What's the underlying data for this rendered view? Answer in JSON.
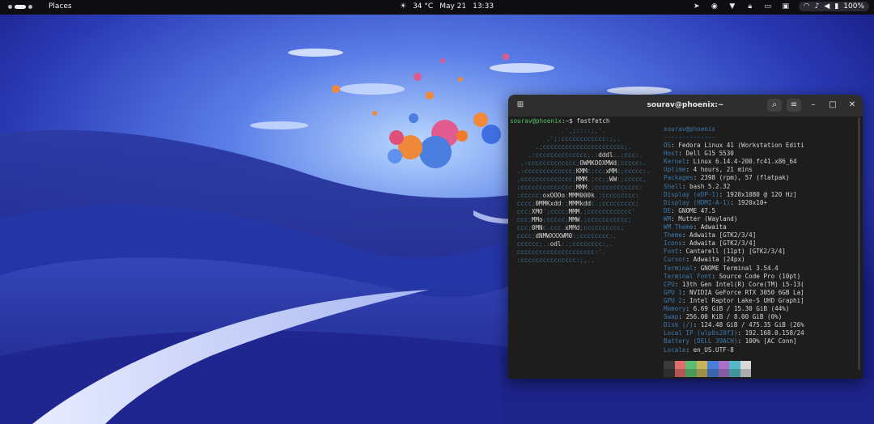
{
  "topbar": {
    "places_label": "Places",
    "weather": "34 °C",
    "date": "May 21",
    "time": "13:33",
    "tray_icons": [
      "telegram-icon",
      "discord-icon",
      "vpn-icon",
      "lock-icon",
      "flag-icon",
      "window-icon"
    ],
    "battery": "100%"
  },
  "terminal": {
    "title": "sourav@phoenix:~",
    "prompt_user": "sourav@phoenix",
    "prompt_rest": ":~$ ",
    "command": "fastfetch",
    "header": "sourav@phoenix",
    "divider": "--------------",
    "info": [
      {
        "k": "OS",
        "v": ": Fedora Linux 41 (Workstation Editi"
      },
      {
        "k": "Host",
        "v": ": Dell G15 5530"
      },
      {
        "k": "Kernel",
        "v": ": Linux 6.14.4-200.fc41.x86_64"
      },
      {
        "k": "Uptime",
        "v": ": 4 hours, 21 mins"
      },
      {
        "k": "Packages",
        "v": ": 2398 (rpm), 57 (flatpak)"
      },
      {
        "k": "Shell",
        "v": ": bash 5.2.32"
      },
      {
        "k": "Display (eDP-1)",
        "v": ": 1920x1080 @ 120 Hz]"
      },
      {
        "k": "Display (HDMI-A-1)",
        "v": ": 1920x10+"
      },
      {
        "k": "DE",
        "v": ": GNOME 47.5"
      },
      {
        "k": "WM",
        "v": ": Mutter (Wayland)"
      },
      {
        "k": "WM Theme",
        "v": ": Adwaita"
      },
      {
        "k": "Theme",
        "v": ": Adwaita [GTK2/3/4]"
      },
      {
        "k": "Icons",
        "v": ": Adwaita [GTK2/3/4]"
      },
      {
        "k": "Font",
        "v": ": Cantarell (11pt) [GTK2/3/4]"
      },
      {
        "k": "Cursor",
        "v": ": Adwaita (24px)"
      },
      {
        "k": "Terminal",
        "v": ": GNOME Terminal 3.54.4"
      },
      {
        "k": "Terminal Font",
        "v": ": Source Code Pro (10pt)"
      },
      {
        "k": "CPU",
        "v": ": 13th Gen Intel(R) Core(TM) i5-13("
      },
      {
        "k": "GPU 1",
        "v": ": NVIDIA GeForce RTX 3050 6GB La]"
      },
      {
        "k": "GPU 2",
        "v": ": Intel Raptor Lake-S UHD Graphi]"
      },
      {
        "k": "Memory",
        "v": ": 6.69 GiB / 15.30 GiB (44%)"
      },
      {
        "k": "Swap",
        "v": ": 256.00 KiB / 8.00 GiB (0%)"
      },
      {
        "k": "Disk (/)",
        "v": ": 124.48 GiB / 475.35 GiB (26%"
      },
      {
        "k": "Local IP (wlp0s20f3)",
        "v": ": 192.168.0.158/24"
      },
      {
        "k": "Battery (DELL 39ACH)",
        "v": ": 100% [AC Conn]"
      },
      {
        "k": "Locale",
        "v": ": en_US.UTF-8"
      }
    ],
    "logo_lines": [
      "             .',;::::;,'.",
      "         .';:cccccccccccc:;,.",
      "      .;cccccccccccccccccccccc;.",
      "    .:cccccccccccccc;.:dddl:.;ccc:.",
      "  .:ccccccccccccc;OWMKOOXMWd;ccccc:.",
      " .:ccccccccccccc;KMMc;cc;xMMc;ccccc:.",
      " ,cccccccccccccc;MMM.;cc;;WW:;ccccc,",
      " :cccccccccccccc;MMM.;cccccccccccc:",
      " :ccccc;oxOOOo;MMM000k.;ccccccccc:",
      " cccc;0MMKxdd:;MMMkddc.;ccccccccc;",
      " ccc;XMO';cccc;MMM.;cccccccccccc'",
      " ccc;MMo;ccccc;MMW.;ccccccccccc;",
      " ccc;0MNc.ccc.xMMd;cccccccccc;",
      " cccc;dNMWXXXWM0:;cccccccc:,",
      " cccccc;.:odl:.;cccccccc:,.",
      " ccccccccccccccccccccc:'.",
      " :ccccccccccccccc:;,.."
    ],
    "swatch_colors": [
      "#3a3a3a",
      "#e06c6c",
      "#5bbf72",
      "#c6b35a",
      "#4a7fd6",
      "#a870c8",
      "#55b9c8",
      "#d8d8d8"
    ]
  }
}
